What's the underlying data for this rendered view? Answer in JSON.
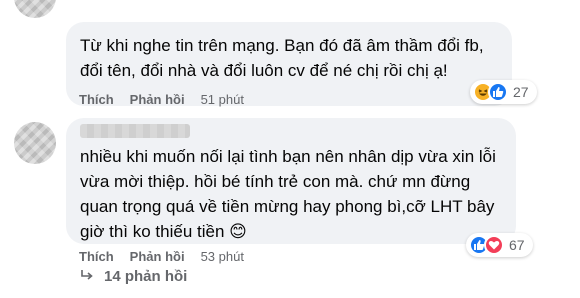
{
  "comments": [
    {
      "text": "Từ khi nghe tin trên mạng. Bạn đó đã âm thầm đổi fb,\nđổi tên, đổi nhà và đổi luôn cv để né chị rồi chị ạ!",
      "like_label": "Thích",
      "reply_label": "Phản hồi",
      "time": "51 phút",
      "reaction_count": "27",
      "reaction_icons": [
        "haha-icon",
        "like-icon"
      ]
    },
    {
      "text": "nhiều khi muốn nối lại tình bạn nên nhân dịp vừa xin lỗi\nvừa mời thiệp. hồi bé tính trẻ con mà. chứ mn đừng\nquan trọng quá về tiền mừng hay phong bì,cỡ LHT bây\ngiờ thì ko thiếu tiền 😊",
      "like_label": "Thích",
      "reply_label": "Phản hồi",
      "time": "53 phút",
      "reaction_count": "67",
      "reaction_icons": [
        "like-icon",
        "love-icon"
      ]
    }
  ],
  "view_replies": "14 phản hồi",
  "colors": {
    "bubble": "#f0f2f5",
    "meta_text": "#65676b",
    "like_blue": "#1877f2",
    "love_red": "#f33e58",
    "haha_yellow": "#f7b125"
  }
}
